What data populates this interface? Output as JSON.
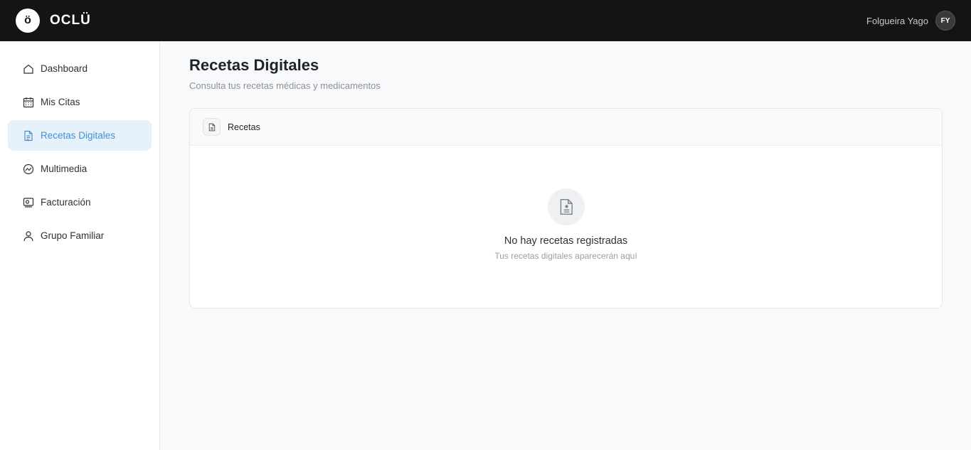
{
  "header": {
    "logo_glyph": "ö",
    "brand": "OCLÜ",
    "user_name": "Folgueira Yago",
    "user_initials": "FY"
  },
  "sidebar": {
    "items": [
      {
        "label": "Dashboard",
        "icon": "home-icon"
      },
      {
        "label": "Mis Citas",
        "icon": "calendar-icon"
      },
      {
        "label": "Recetas Digitales",
        "icon": "document-icon",
        "active": true
      },
      {
        "label": "Multimedia",
        "icon": "chart-icon"
      },
      {
        "label": "Facturación",
        "icon": "invoice-icon"
      },
      {
        "label": "Grupo Familiar",
        "icon": "user-icon"
      }
    ]
  },
  "page": {
    "title": "Recetas Digitales",
    "subtitle": "Consulta tus recetas médicas y medicamentos"
  },
  "card": {
    "title": "Recetas",
    "empty_title": "No hay recetas registradas",
    "empty_subtitle": "Tus recetas digitales aparecerán aquí"
  },
  "colors": {
    "topbar": "#141414",
    "active_bg": "#e5f1fb",
    "active_text": "#4a8fce"
  }
}
